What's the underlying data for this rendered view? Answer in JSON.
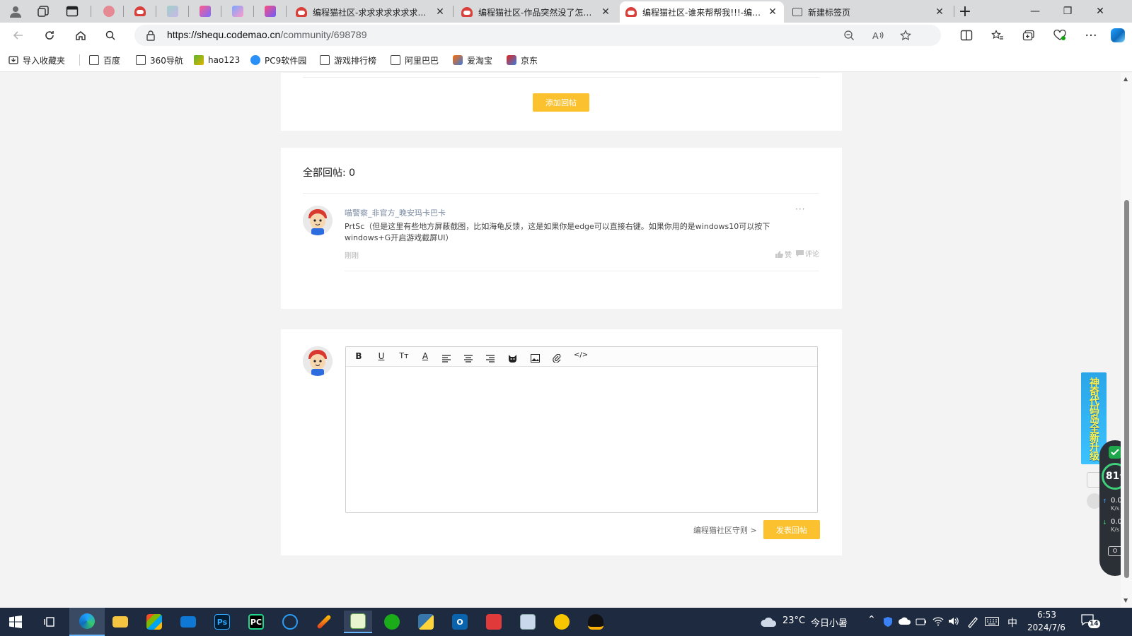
{
  "browser": {
    "tabs": [
      {
        "title": "编程猫社区-求求求求求求求求求求",
        "active": false
      },
      {
        "title": "编程猫社区-作品突然没了怎么办",
        "active": false
      },
      {
        "title": "编程猫社区-谁来帮帮我!!!-编程猫",
        "active": true
      },
      {
        "title": "新建标签页",
        "active": false
      }
    ],
    "url_host": "https://shequ.codemao.cn",
    "url_path": "/community/698789",
    "new_tab_symbol": "+",
    "window_controls": {
      "minimize": "—",
      "restore": "❐",
      "close": "✕"
    }
  },
  "bookmarks": [
    {
      "label": "导入收藏夹",
      "icon": "import-icon"
    },
    {
      "label": "百度",
      "icon": "doc-icon"
    },
    {
      "label": "360导航",
      "icon": "doc-icon"
    },
    {
      "label": "hao123",
      "icon": "hao123-icon"
    },
    {
      "label": "PC9软件园",
      "icon": "pc9-icon"
    },
    {
      "label": "游戏排行榜",
      "icon": "doc-icon"
    },
    {
      "label": "阿里巴巴",
      "icon": "doc-icon"
    },
    {
      "label": "爱淘宝",
      "icon": "taobao-icon"
    },
    {
      "label": "京东",
      "icon": "jd-icon"
    }
  ],
  "page": {
    "add_reply_button": "添加回帖",
    "replies_heading": "全部回帖: 0",
    "reply": {
      "author": "喵警察_非官方_晚安玛卡巴卡",
      "content": "PrtSc（但是这里有些地方屏蔽截图，比如海龟反馈，这是如果你是edge可以直接右键。如果你用的是windows10可以按下windows+G开启游戏截屏UI）",
      "time": "刚刚",
      "like_label": "赞",
      "comment_label": "评论",
      "more_label": "···"
    },
    "editor_toolbar": [
      {
        "name": "bold-button",
        "label": "B"
      },
      {
        "name": "underline-button",
        "label": "U"
      },
      {
        "name": "font-size-button",
        "label": "Tт"
      },
      {
        "name": "font-color-button",
        "label": "A"
      },
      {
        "name": "align-left-button",
        "label": ""
      },
      {
        "name": "align-center-button",
        "label": ""
      },
      {
        "name": "align-right-button",
        "label": ""
      },
      {
        "name": "emoji-button",
        "label": ""
      },
      {
        "name": "image-button",
        "label": ""
      },
      {
        "name": "attachment-button",
        "label": ""
      },
      {
        "name": "code-button",
        "label": "</>"
      }
    ],
    "rules_link": "编程猫社区守则 >",
    "post_reply_button": "发表回帖"
  },
  "widget": {
    "banner_text": "神奇代码岛全新升级",
    "score": "81",
    "score_unit": "%",
    "upload": "0.0",
    "download": "0.0",
    "speed_unit": "K/s"
  },
  "taskbar": {
    "weather_temp": "23°C",
    "weather_desc": "今日小暑",
    "ime": "中",
    "time": "6:53",
    "date": "2024/7/6",
    "notifications": "14"
  },
  "colors": {
    "accent_yellow": "#fbc12f",
    "edge_blue": "#0f6cbd",
    "taskbar": "#1e2a3f"
  }
}
